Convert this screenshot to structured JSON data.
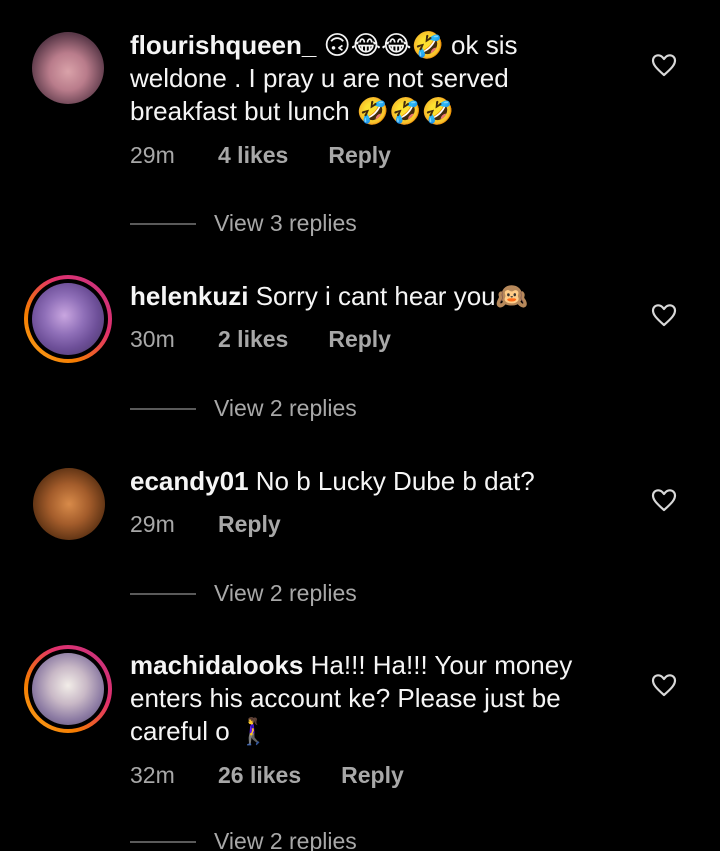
{
  "comments": [
    {
      "username": "flourishqueen_",
      "text_line1": "🙃😂😂🤣 ok sis",
      "text_line2": "weldone . I pray u are not served",
      "text_line3": "breakfast but lunch 🤣🤣🤣",
      "time": "29m",
      "likes": "4 likes",
      "reply_label": "Reply",
      "view_replies": "View 3 replies",
      "avatar_icon": "profile-photo",
      "has_story_ring": false
    },
    {
      "username": "helenkuzi",
      "text_line1": "Sorry i cant hear you🙉",
      "time": "30m",
      "likes": "2 likes",
      "reply_label": "Reply",
      "view_replies": "View 2 replies",
      "avatar_icon": "profile-photo",
      "has_story_ring": true
    },
    {
      "username": "ecandy01",
      "text_line1": "No b Lucky Dube b dat?",
      "time": "29m",
      "likes": "",
      "reply_label": "Reply",
      "view_replies": "View 2 replies",
      "avatar_icon": "profile-photo",
      "has_story_ring": false
    },
    {
      "username": "machidalooks",
      "text_line1": "Ha!!! Ha!!! Your money",
      "text_line2": "enters his account ke? Please just be",
      "text_line3": "careful o 🚶‍♀️",
      "time": "32m",
      "likes": "26 likes",
      "reply_label": "Reply",
      "view_replies": "View 2 replies",
      "avatar_icon": "profile-photo",
      "has_story_ring": true
    }
  ],
  "icons": {
    "like": "heart-outline-icon"
  },
  "colors": {
    "background": "#000000",
    "text": "#f5f5f5",
    "secondary": "#a8a8a8",
    "story_ring_start": "#f9a825",
    "story_ring_end": "#c13584"
  }
}
